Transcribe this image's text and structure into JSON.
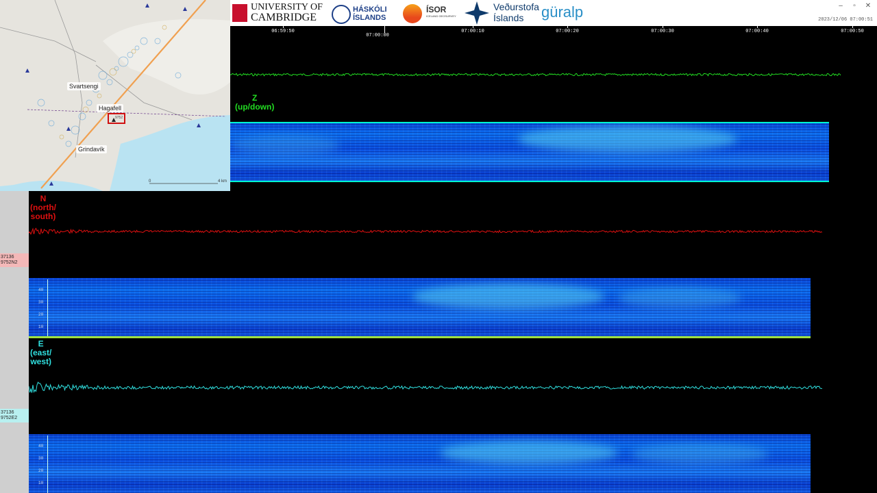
{
  "map": {
    "places": [
      "Svartsengi",
      "Hagafell",
      "Grindavík"
    ],
    "station_marker": "9752",
    "scale": {
      "start": "0",
      "end": "4 km"
    }
  },
  "header": {
    "logos": [
      {
        "name": "UNIVERSITY OF CAMBRIDGE",
        "line1": "UNIVERSITY OF",
        "line2": "CAMBRIDGE"
      },
      {
        "name": "HÁSKÓLI ÍSLANDS",
        "line1": "HÁSKÓLI",
        "line2": "ÍSLANDS"
      },
      {
        "name": "ÍSOR",
        "line1": "ÍSOR",
        "line2": "ICELAND GEOSURVEY"
      },
      {
        "name": "Veðurstofa Íslands",
        "line1": "Veðurstofa",
        "line2": "Íslands"
      },
      {
        "name": "güralp",
        "line1": "güralp"
      }
    ],
    "timestamp": "2023/12/06 07:00:51",
    "window_controls": [
      "–",
      "▫",
      "✕"
    ]
  },
  "time_axis": {
    "labels": [
      "06:59:50",
      "07:00:00",
      "07:00:10",
      "07:00:20",
      "07:00:30",
      "07:00:40",
      "07:00:50"
    ]
  },
  "channels": {
    "z": {
      "label": "Z",
      "sub": "(up/down)",
      "color": "#22dd22"
    },
    "n": {
      "label": "N",
      "sub1": "(north/",
      "sub2": "south)",
      "color": "#e01010"
    },
    "e": {
      "label": "E",
      "sub1": "(east/",
      "sub2": "west)",
      "color": "#30e0e0"
    }
  },
  "stations": {
    "n": {
      "id": "37136",
      "code": "9752N2",
      "bg": "#f4b8b8"
    },
    "e": {
      "id": "37136",
      "code": "9752E2",
      "bg": "#b8f0f0"
    }
  },
  "spectrogram_axis": {
    "ticks": [
      "40",
      "30",
      "20",
      "10"
    ]
  },
  "colors": {
    "background": "#000000",
    "spectrogram_edge": "#00ffd0"
  }
}
